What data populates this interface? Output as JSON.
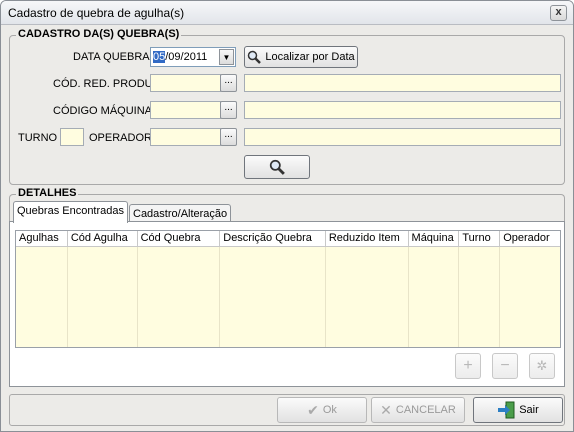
{
  "window": {
    "title": "Cadastro de quebra de agulha(s)",
    "close_glyph": "x"
  },
  "search_group": {
    "title": "CADASTRO DA(S) QUEBRA(S)",
    "date_label": "DATA QUEBRA",
    "date_day": "05",
    "date_rest": "/09/2011",
    "locate_button": "Localizar por Data",
    "product_label": "CÓD. RED. PRODUTO",
    "machine_label": "CÓDIGO MÁQUINA",
    "shift_label": "TURNO",
    "operator_label": "OPERADOR",
    "lookup_glyph": "..."
  },
  "details_group": {
    "title": "DETALHES",
    "tabs": [
      {
        "label": "Quebras Encontradas",
        "active": true
      },
      {
        "label": "Cadastro/Alteração",
        "active": false
      }
    ],
    "columns": [
      "Agulhas",
      "Cód Agulha",
      "Cód Quebra",
      "Descrição Quebra",
      "Reduzido Item",
      "Máquina",
      "Turno",
      "Operador"
    ],
    "rows": []
  },
  "footer": {
    "ok_label": "Ok",
    "cancel_label": "CANCELAR",
    "exit_label": "Sair"
  },
  "colors": {
    "field_bg": "#fffde0",
    "window_bg": "#ecebe8",
    "selection": "#316ac5"
  }
}
